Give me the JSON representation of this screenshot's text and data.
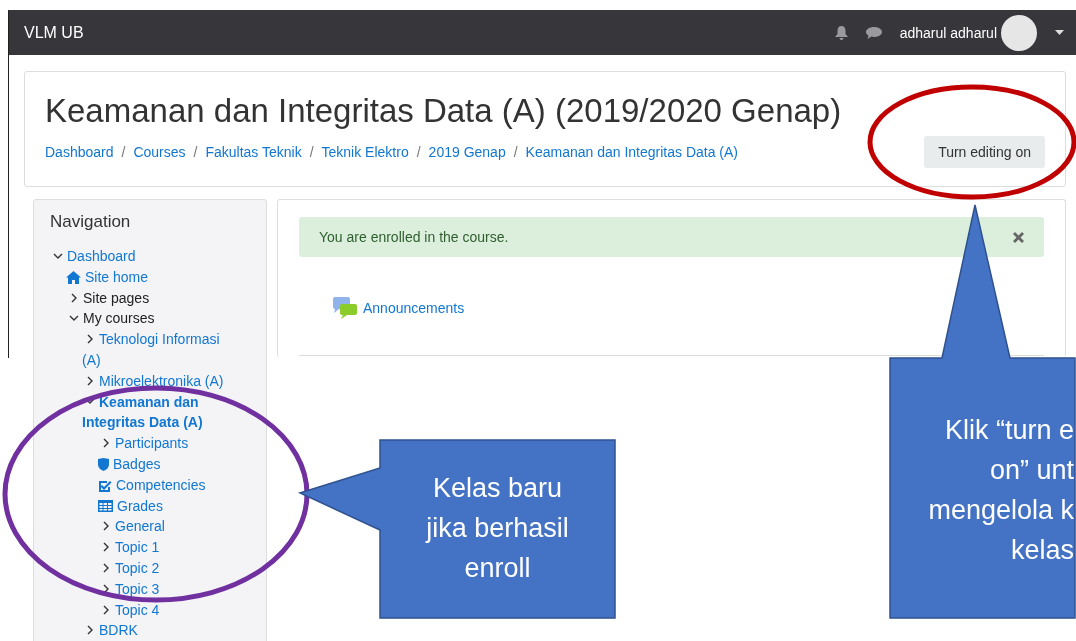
{
  "navbar": {
    "brand": "VLM UB",
    "user": "adharul adharul"
  },
  "header": {
    "title": "Keamanan dan Integritas Data (A) (2019/2020 Genap)",
    "breadcrumbs": [
      "Dashboard",
      "Courses",
      "Fakultas Teknik",
      "Teknik Elektro",
      "2019 Genap",
      "Keamanan dan Integritas Data (A)"
    ],
    "separator": "/",
    "button": "Turn editing on"
  },
  "navigation": {
    "title": "Navigation",
    "items": [
      {
        "label": "Dashboard",
        "kind": "link",
        "expanded": true,
        "children": [
          {
            "label": "Site home",
            "kind": "home"
          },
          {
            "label": "Site pages",
            "kind": "plain",
            "expanded": false
          },
          {
            "label": "My courses",
            "kind": "plain",
            "expanded": true,
            "children": [
              {
                "label": "Teknologi Informasi (A)",
                "kind": "link",
                "expanded": false
              },
              {
                "label": "Mikroelektronika (A)",
                "kind": "link",
                "expanded": false
              },
              {
                "label": "Keamanan dan Integritas Data (A)",
                "kind": "current",
                "expanded": true,
                "children": [
                  {
                    "label": "Participants",
                    "kind": "link",
                    "expanded": false
                  },
                  {
                    "label": "Badges",
                    "kind": "badge"
                  },
                  {
                    "label": "Competencies",
                    "kind": "competency"
                  },
                  {
                    "label": "Grades",
                    "kind": "grades"
                  },
                  {
                    "label": "General",
                    "kind": "link",
                    "expanded": false
                  },
                  {
                    "label": "Topic 1",
                    "kind": "link",
                    "expanded": false
                  },
                  {
                    "label": "Topic 2",
                    "kind": "link",
                    "expanded": false
                  },
                  {
                    "label": "Topic 3",
                    "kind": "link",
                    "expanded": false
                  },
                  {
                    "label": "Topic 4",
                    "kind": "link",
                    "expanded": false
                  }
                ]
              },
              {
                "label": "BDRK",
                "kind": "link",
                "expanded": false
              }
            ]
          }
        ]
      }
    ]
  },
  "alert": {
    "text": "You are enrolled in the course."
  },
  "activities": [
    {
      "label": "Announcements"
    }
  ],
  "callouts": [
    {
      "lines": [
        "Kelas baru",
        "jika berhasil",
        "enroll"
      ]
    },
    {
      "lines": [
        "Klik “turn e",
        "on” unt",
        "mengelola k",
        "kelas"
      ]
    }
  ]
}
